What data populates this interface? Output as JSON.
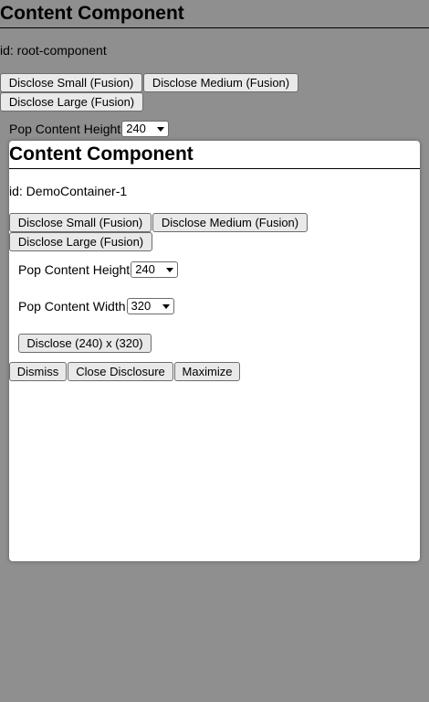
{
  "root": {
    "title": "Content Component",
    "id_label": "id: root-component",
    "buttons": {
      "small": "Disclose Small (Fusion)",
      "medium": "Disclose Medium (Fusion)",
      "large": "Disclose Large (Fusion)"
    },
    "pop_height": {
      "label": "Pop Content Height",
      "value": "240"
    }
  },
  "panel": {
    "title": "Content Component",
    "id_label": "id: DemoContainer-1",
    "buttons": {
      "small": "Disclose Small (Fusion)",
      "medium": "Disclose Medium (Fusion)",
      "large": "Disclose Large (Fusion)"
    },
    "pop_height": {
      "label": "Pop Content Height",
      "value": "240"
    },
    "pop_width": {
      "label": "Pop Content Width",
      "value": "320"
    },
    "disclose_button": "Disclose (240) x (320)",
    "actions": {
      "dismiss": "Dismiss",
      "close": "Close Disclosure",
      "maximize": "Maximize"
    }
  },
  "icons": {
    "dropdown": "chevron-down-icon"
  }
}
